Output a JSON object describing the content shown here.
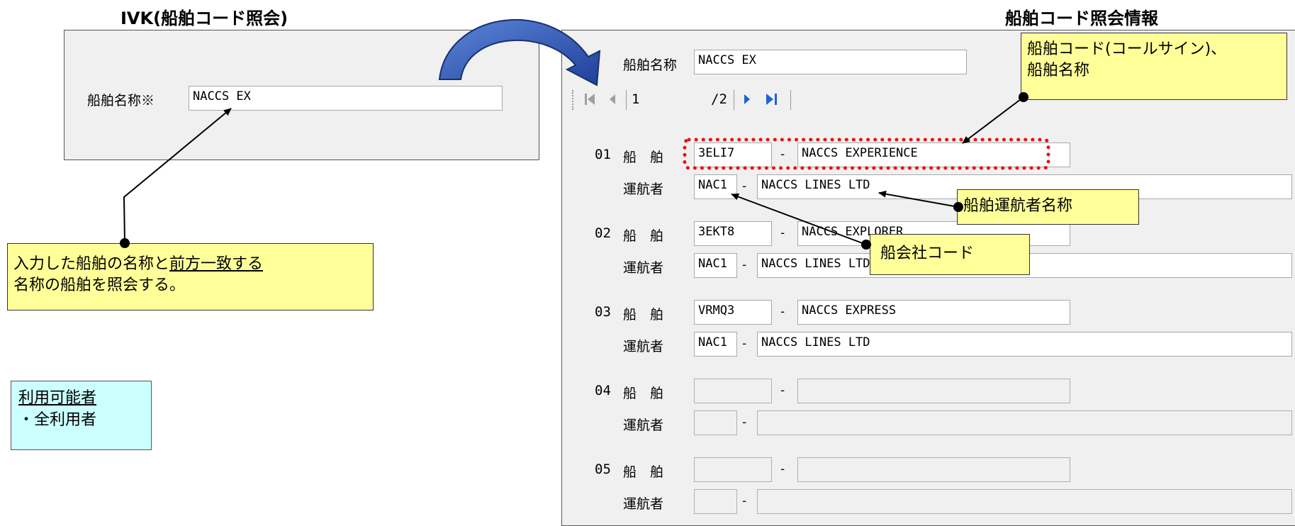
{
  "left_title": "IVK(船舶コード照会)",
  "right_title": "船舶コード照会情報",
  "input_form": {
    "label": "船舶名称※",
    "value": "NACCS EX"
  },
  "note_search": {
    "line1_a": "入力した船舶の名称と",
    "line1_b": "前方一致する",
    "line2": "名称の船舶を照会する。"
  },
  "availability": {
    "heading": "利用可能者",
    "item": "・全利用者"
  },
  "result": {
    "name_label": "船舶名称",
    "name_value": "NACCS EX",
    "pager": {
      "current": "1",
      "total": "/2"
    },
    "vessel_label": "船　舶",
    "operator_label": "運航者",
    "separator": "-",
    "rows": [
      {
        "no": "01",
        "code": "3ELI7",
        "vessel": "NACCS EXPERIENCE",
        "op_code": "NAC1",
        "op_name": "NACCS LINES LTD"
      },
      {
        "no": "02",
        "code": "3EKT8",
        "vessel": "NACCS EXPLORER",
        "op_code": "NAC1",
        "op_name": "NACCS LINES LTD"
      },
      {
        "no": "03",
        "code": "VRMQ3",
        "vessel": "NACCS EXPRESS",
        "op_code": "NAC1",
        "op_name": "NACCS LINES LTD"
      },
      {
        "no": "04",
        "code": "",
        "vessel": "",
        "op_code": "",
        "op_name": ""
      },
      {
        "no": "05",
        "code": "",
        "vessel": "",
        "op_code": "",
        "op_name": ""
      }
    ]
  },
  "callouts": {
    "ship_code": {
      "line1": "船舶コード(コールサイン)、",
      "line2": "船舶名称"
    },
    "operator_name": "船舶運航者名称",
    "company_code": "船会社コード"
  },
  "colors": {
    "note_bg": "#ffff99",
    "avail_bg": "#ccffff",
    "arrow_blue": "#1f3f9a",
    "highlight_red": "#ee1111"
  },
  "icons": [
    "first-page-icon",
    "prev-page-icon",
    "next-page-icon",
    "last-page-icon",
    "curved-arrow-icon"
  ]
}
